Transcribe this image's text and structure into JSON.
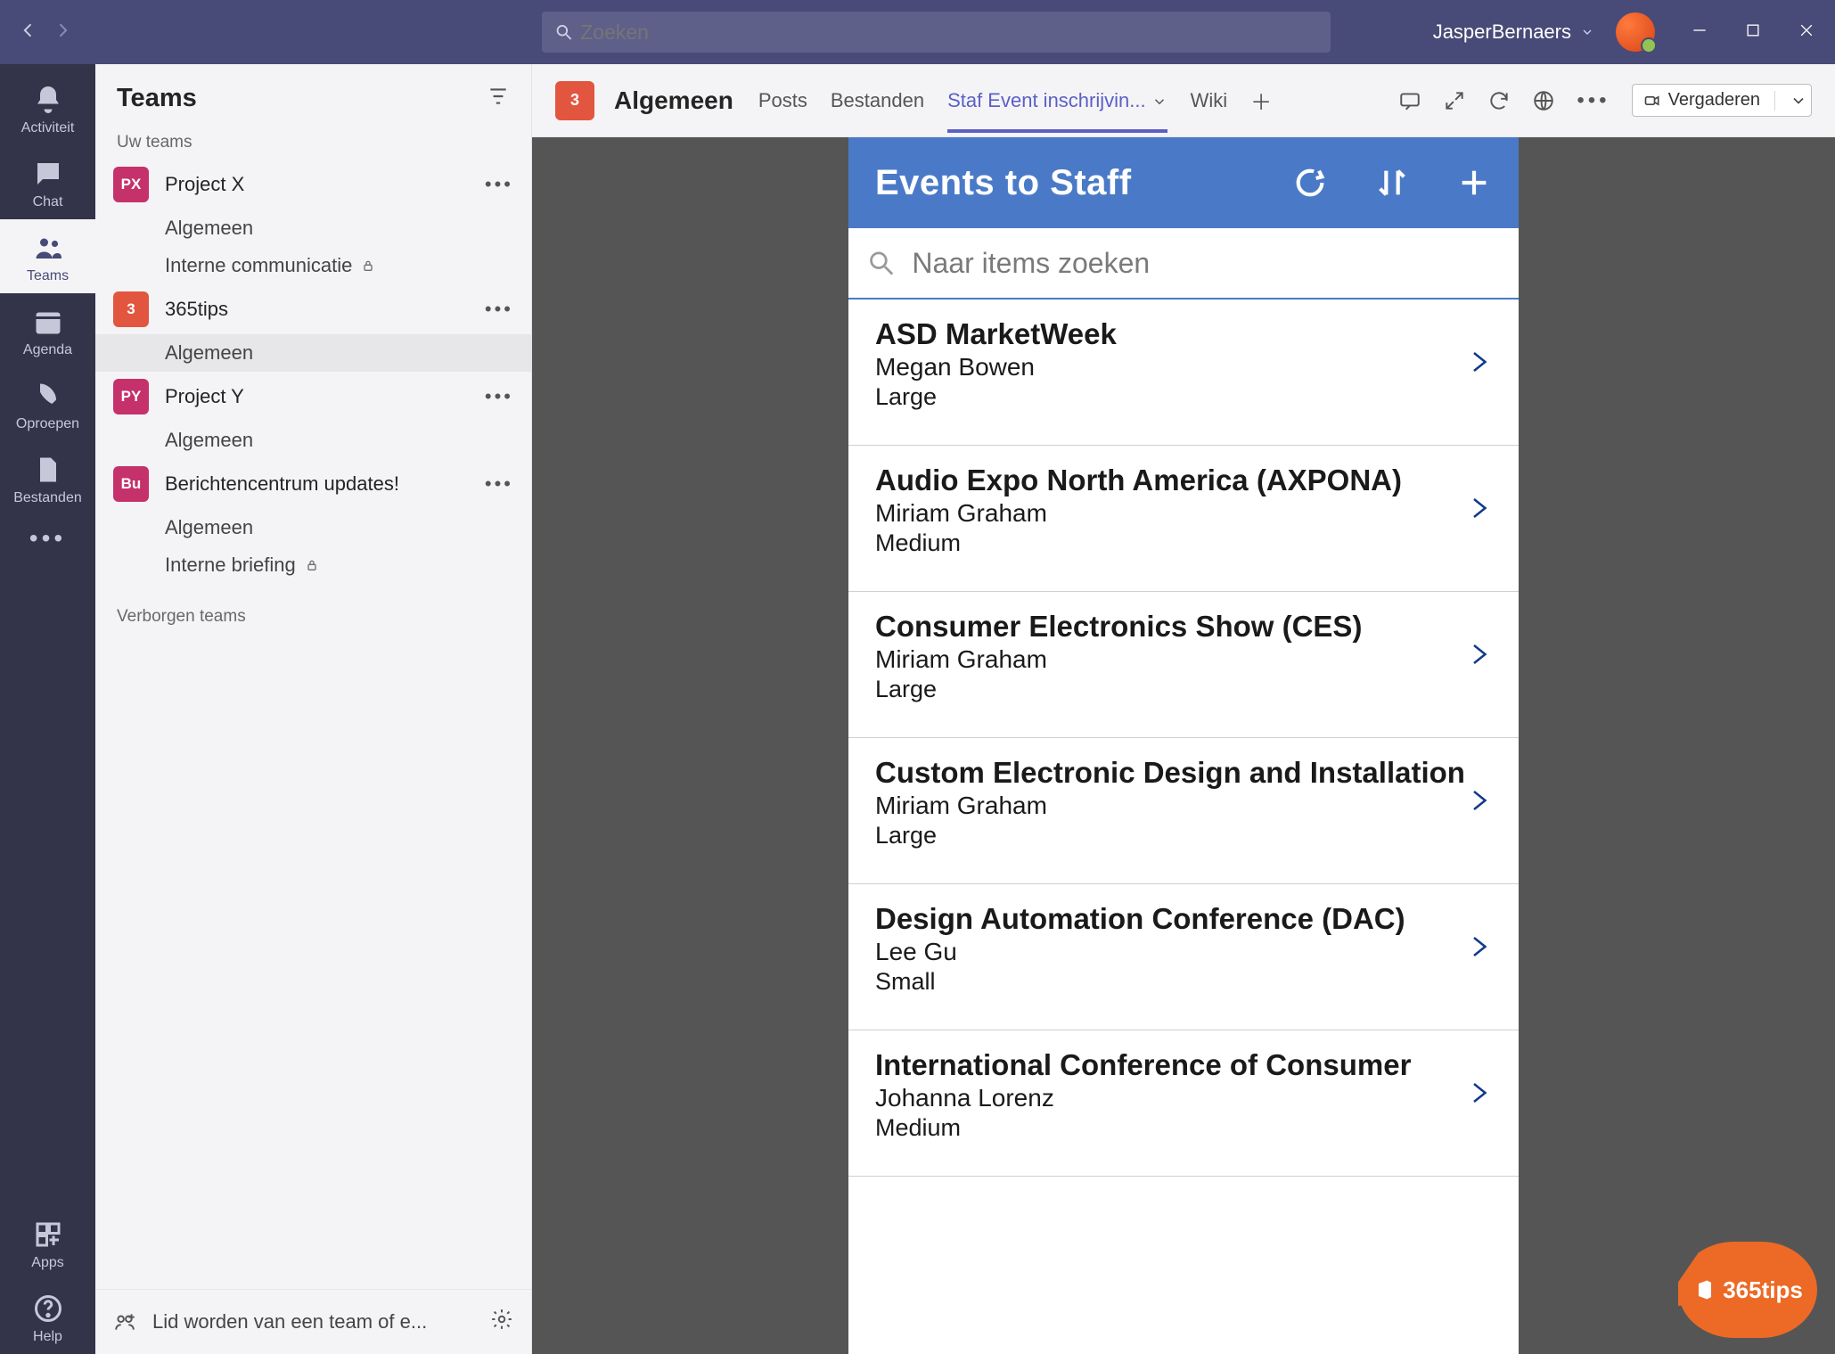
{
  "titlebar": {
    "search_placeholder": "Zoeken",
    "user_name": "JasperBernaers"
  },
  "apprail": {
    "activity": "Activiteit",
    "chat": "Chat",
    "teams": "Teams",
    "agenda": "Agenda",
    "calls": "Oproepen",
    "files": "Bestanden",
    "apps": "Apps",
    "help": "Help"
  },
  "sidepanel": {
    "title": "Teams",
    "section_your_teams": "Uw teams",
    "hidden": "Verborgen teams",
    "footer": "Lid worden van een team of e...",
    "teams": [
      {
        "name": "Project X",
        "initials": "PX",
        "color": "pink",
        "channels": [
          {
            "label": "Algemeen",
            "private": false,
            "active": false
          },
          {
            "label": "Interne communicatie",
            "private": true,
            "active": false
          }
        ]
      },
      {
        "name": "365tips",
        "initials": "3",
        "color": "orange",
        "channels": [
          {
            "label": "Algemeen",
            "private": false,
            "active": true
          }
        ]
      },
      {
        "name": "Project Y",
        "initials": "PY",
        "color": "pink",
        "channels": [
          {
            "label": "Algemeen",
            "private": false,
            "active": false
          }
        ]
      },
      {
        "name": "Berichtencentrum updates!",
        "initials": "Bu",
        "color": "pink",
        "channels": [
          {
            "label": "Algemeen",
            "private": false,
            "active": false
          },
          {
            "label": "Interne briefing",
            "private": true,
            "active": false
          }
        ]
      }
    ]
  },
  "channel": {
    "avatar_text": "3",
    "name": "Algemeen",
    "tabs": {
      "posts": "Posts",
      "files": "Bestanden",
      "staf": "Staf Event inschrijvin...",
      "wiki": "Wiki"
    },
    "meet_label": "Vergaderen"
  },
  "pane": {
    "title": "Events to Staff",
    "search_placeholder": "Naar items zoeken",
    "events": [
      {
        "title": "ASD MarketWeek",
        "person": "Megan Bowen",
        "size": "Large"
      },
      {
        "title": "Audio Expo North America (AXPONA)",
        "person": "Miriam Graham",
        "size": "Medium"
      },
      {
        "title": "Consumer Electronics Show (CES)",
        "person": "Miriam Graham",
        "size": "Large"
      },
      {
        "title": "Custom Electronic Design and Installation",
        "person": "Miriam Graham",
        "size": "Large"
      },
      {
        "title": "Design Automation Conference (DAC)",
        "person": "Lee Gu",
        "size": "Small"
      },
      {
        "title": "International Conference of Consumer",
        "person": "Johanna Lorenz",
        "size": "Medium"
      }
    ]
  },
  "badge": {
    "label": "365tips"
  }
}
